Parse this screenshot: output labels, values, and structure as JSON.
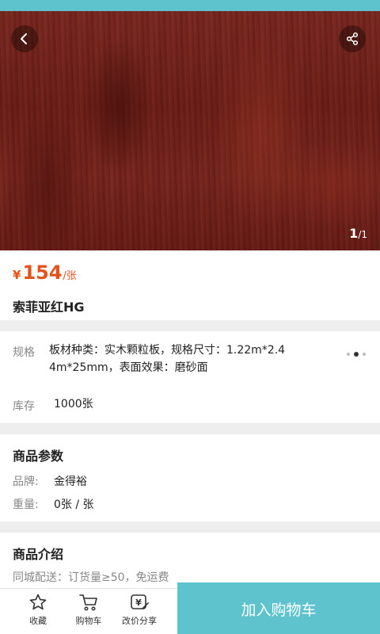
{
  "header": {
    "image_counter_current": "1",
    "image_counter_total": "/1"
  },
  "product": {
    "price_currency": "¥",
    "price_value": "154",
    "price_unit": "/张",
    "title": "索菲亚红HG"
  },
  "spec": {
    "label": "规格",
    "line1": "板材种类：实木颗粒板，规格尺寸：1.22m*2.4",
    "line2": "4m*25mm，表面效果：磨砂面",
    "stock_label": "库存",
    "stock_value": "1000张"
  },
  "params": {
    "title": "商品参数",
    "brand_label": "品牌:",
    "brand_value": "金得裕",
    "weight_label": "重量:",
    "weight_value": "0张 / 张"
  },
  "intro": {
    "title": "商品介绍",
    "text": "同城配送：订货量≥50，免运费"
  },
  "bottom_bar": {
    "favorite_label": "收藏",
    "cart_label": "购物车",
    "share_label": "改价分享",
    "add_to_cart_label": "加入购物车"
  },
  "colors": {
    "accent": "#5ec3cc",
    "price": "#e4521c"
  },
  "icons": [
    "back-arrow-icon",
    "share-icon",
    "star-icon",
    "cart-icon",
    "price-tag-icon",
    "more-dots-icon"
  ]
}
